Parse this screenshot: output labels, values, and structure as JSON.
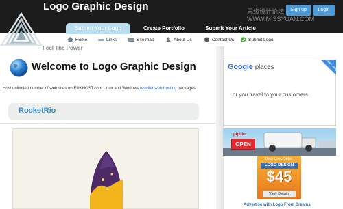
{
  "header": {
    "site_title": "Logo Graphic Design",
    "signup_label": "Sign up",
    "login_label": "Login",
    "watermark": "思缘设计论坛 WWW.MISSYUAN.COM"
  },
  "tabs": [
    {
      "label": "Submit Your Logo",
      "active": true
    },
    {
      "label": "Create Portfolio",
      "active": false
    },
    {
      "label": "Submit Your Article",
      "active": false
    }
  ],
  "subnav": [
    {
      "label": "Home",
      "icon": "home-icon"
    },
    {
      "label": "Links",
      "icon": "link-icon"
    },
    {
      "label": "Site map",
      "icon": "sitemap-icon"
    },
    {
      "label": "About Us",
      "icon": "user-icon"
    },
    {
      "label": "Contact Us",
      "icon": "contact-icon"
    },
    {
      "label": "Submit Logo",
      "icon": "check-icon"
    }
  ],
  "tagline": "Feel The Power",
  "main": {
    "welcome": "Welcome to Logo Graphic Design",
    "host_text": "Host unlimited number of web sites on EUKHOST.com Linux and Windows",
    "host_link": "reseller web hosting",
    "host_tail": "packages.",
    "rocketrio_title": "RocketRio"
  },
  "sidebar": {
    "google": "Google",
    "places": "places",
    "free_listing": "Free Listing",
    "google_text": "or you travel to your customers",
    "open_sign": "OPEN",
    "pipl": "pipl.io",
    "ad_best": "Best Logo Seller",
    "ad_logo": "LOGO DESIGN",
    "ad_price": "$45",
    "ad_view": "View Details",
    "ad_caption": "Advertise with Logo From Dreams"
  },
  "colors": {
    "header_bg": "#1c1c1c",
    "accent_blue": "#4d9ad6",
    "active_tab": "#b9dff1",
    "title_blue": "#3a8fc4",
    "ad_orange": "#f0921f"
  }
}
